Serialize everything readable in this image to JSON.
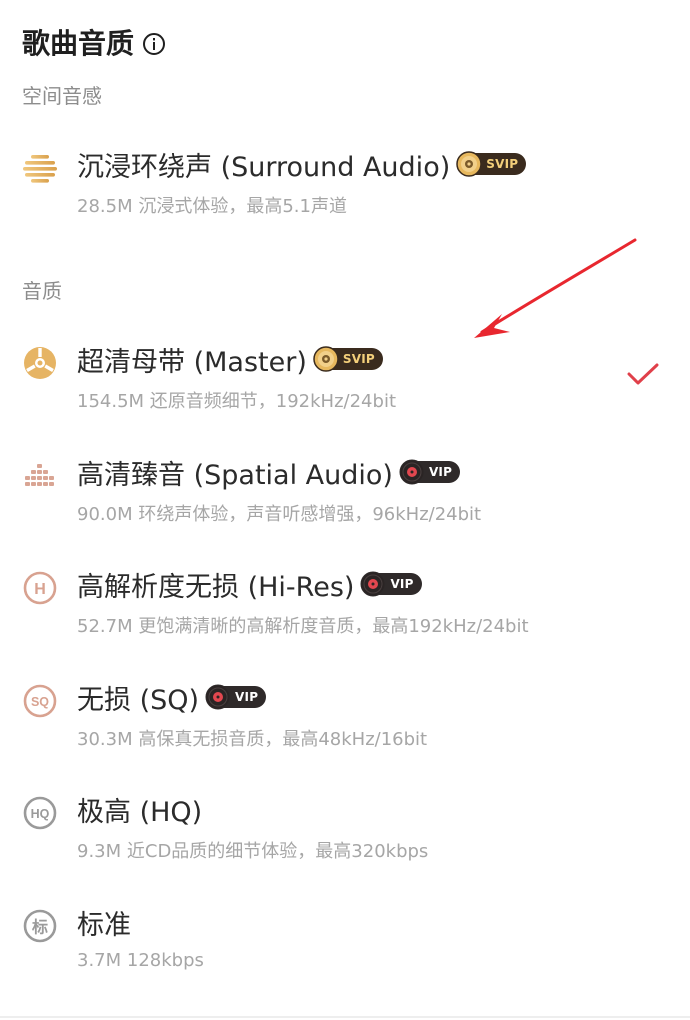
{
  "page": {
    "title": "歌曲音质"
  },
  "sections": {
    "spatial_label": "空间音感",
    "quality_label": "音质"
  },
  "options": [
    {
      "id": "surround",
      "icon": "surround-audio-icon",
      "title": "沉浸环绕声 (Surround Audio)",
      "badge": "SVIP",
      "desc": "28.5M 沉浸式体验，最高5.1声道"
    },
    {
      "id": "master",
      "icon": "master-tape-icon",
      "title": "超清母带 (Master)",
      "badge": "SVIP",
      "desc": "154.5M 还原音频细节，192kHz/24bit",
      "selected": true
    },
    {
      "id": "spatial",
      "icon": "spatial-audio-icon",
      "title": "高清臻音 (Spatial Audio)",
      "badge": "VIP",
      "desc": "90.0M 环绕声体验，声音听感增强，96kHz/24bit"
    },
    {
      "id": "hires",
      "icon": "hi-res-icon",
      "title": "高解析度无损 (Hi-Res)",
      "badge": "VIP",
      "desc": "52.7M 更饱满清晰的高解析度音质，最高192kHz/24bit"
    },
    {
      "id": "sq",
      "icon": "sq-icon",
      "title": "无损 (SQ)",
      "badge": "VIP",
      "desc": "30.3M 高保真无损音质，最高48kHz/16bit"
    },
    {
      "id": "hq",
      "icon": "hq-icon",
      "title": "极高 (HQ)",
      "desc": "9.3M 近CD品质的细节体验，最高320kbps"
    },
    {
      "id": "standard",
      "icon": "standard-icon",
      "title": "标准",
      "icon_glyph": "标",
      "desc": "3.7M 128kbps"
    }
  ],
  "icon_glyphs": {
    "hires": "H",
    "sq": "SQ",
    "hq": "HQ"
  },
  "colors": {
    "gold": "#e3b15d",
    "pink": "#d7a08f",
    "gray": "#9a9a9a",
    "check": "#e0404a",
    "arrow": "#e8272f"
  }
}
